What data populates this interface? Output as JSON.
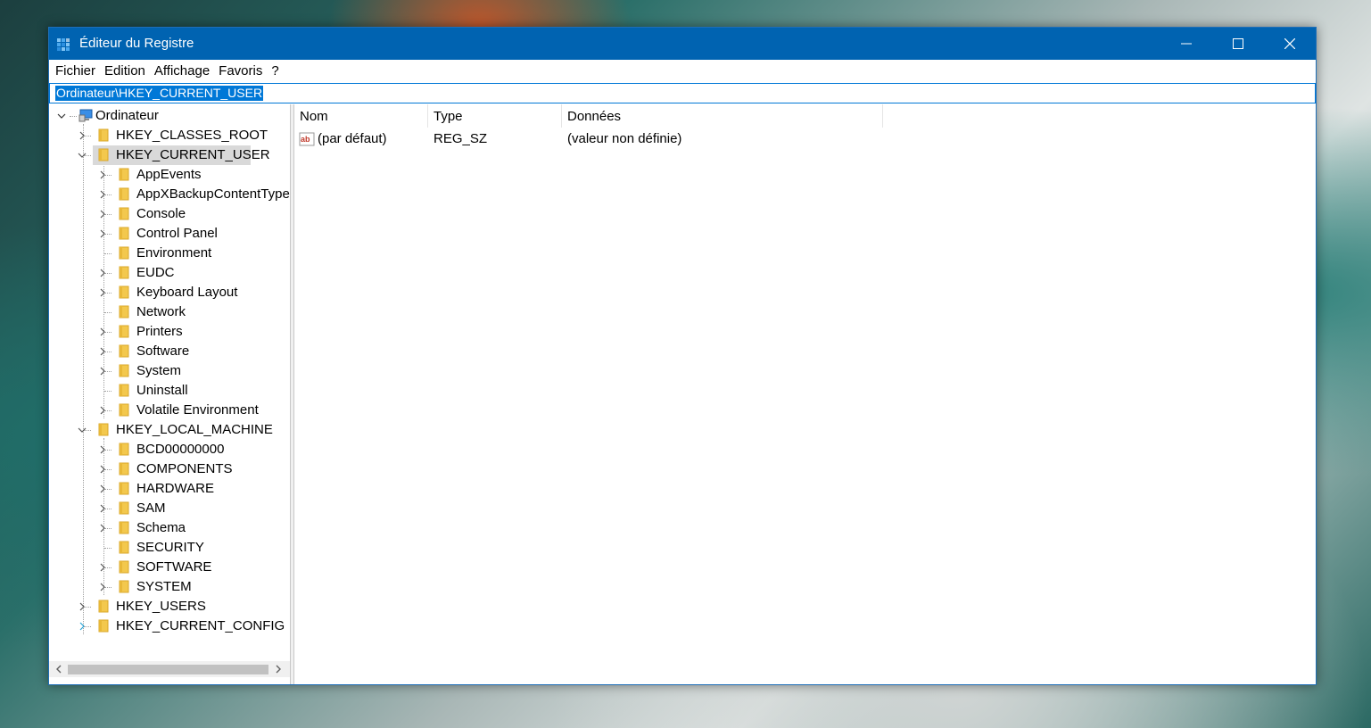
{
  "window": {
    "title": "Éditeur du Registre",
    "controls": [
      "minimize",
      "maximize",
      "close"
    ]
  },
  "menu": [
    "Fichier",
    "Edition",
    "Affichage",
    "Favoris",
    "?"
  ],
  "address": "Ordinateur\\HKEY_CURRENT_USER",
  "tree": {
    "root": "Ordinateur",
    "items": [
      {
        "label": "HKEY_CLASSES_ROOT"
      },
      {
        "label": "HKEY_CURRENT_USER"
      },
      {
        "label": "AppEvents"
      },
      {
        "label": "AppXBackupContentType"
      },
      {
        "label": "Console"
      },
      {
        "label": "Control Panel"
      },
      {
        "label": "Environment"
      },
      {
        "label": "EUDC"
      },
      {
        "label": "Keyboard Layout"
      },
      {
        "label": "Network"
      },
      {
        "label": "Printers"
      },
      {
        "label": "Software"
      },
      {
        "label": "System"
      },
      {
        "label": "Uninstall"
      },
      {
        "label": "Volatile Environment"
      },
      {
        "label": "HKEY_LOCAL_MACHINE"
      },
      {
        "label": "BCD00000000"
      },
      {
        "label": "COMPONENTS"
      },
      {
        "label": "HARDWARE"
      },
      {
        "label": "SAM"
      },
      {
        "label": "Schema"
      },
      {
        "label": "SECURITY"
      },
      {
        "label": "SOFTWARE"
      },
      {
        "label": "SYSTEM"
      },
      {
        "label": "HKEY_USERS"
      },
      {
        "label": "HKEY_CURRENT_CONFIG"
      }
    ]
  },
  "list": {
    "columns": {
      "name": "Nom",
      "type": "Type",
      "data": "Données"
    },
    "rows": [
      {
        "name": "(par défaut)",
        "type": "REG_SZ",
        "data": "(valeur non définie)",
        "icon": "string-value-icon"
      }
    ]
  },
  "colors": {
    "titlebar": "#0063b1",
    "selection": "#0078d7",
    "folder": "#f3c84d"
  }
}
